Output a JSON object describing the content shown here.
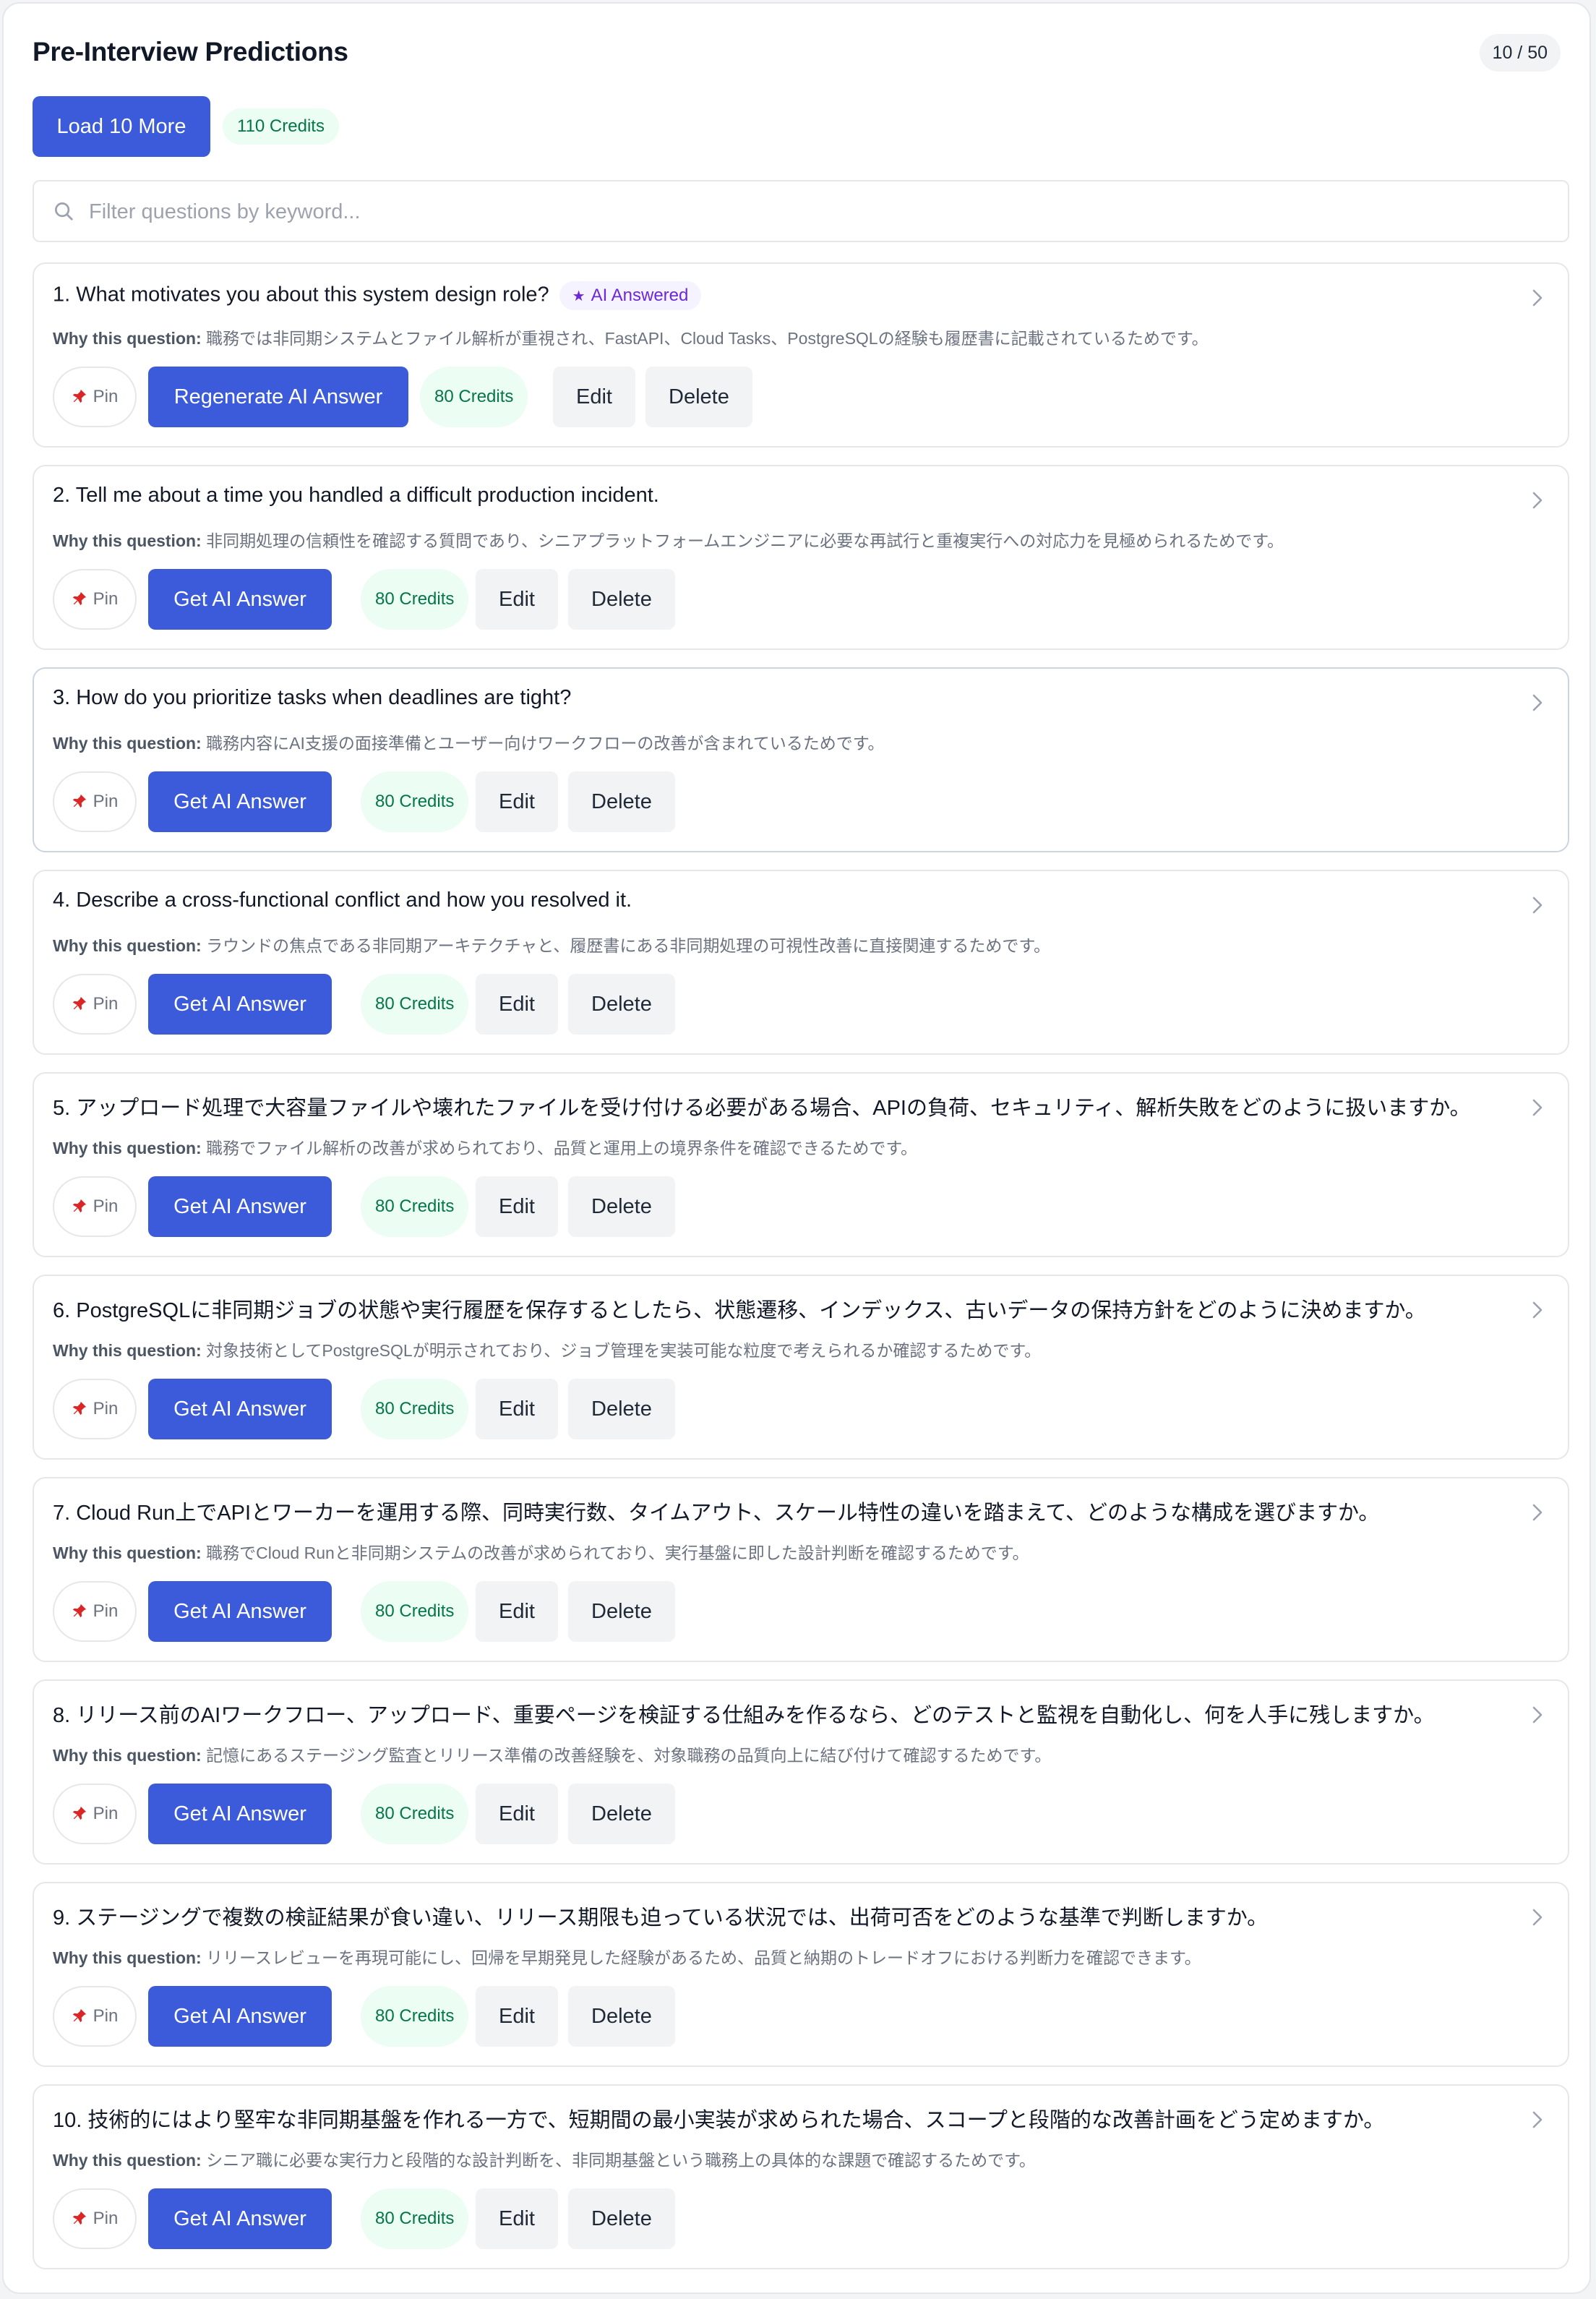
{
  "header": {
    "title": "Pre-Interview Predictions",
    "counter": "10 / 50"
  },
  "toolbar": {
    "load_more_label": "Load 10 More",
    "credits": "110 Credits"
  },
  "search": {
    "placeholder": "Filter questions by keyword...",
    "value": ""
  },
  "labels": {
    "why_prefix": "Why this question:",
    "pin": "Pin",
    "edit": "Edit",
    "delete": "Delete",
    "action_credits": "80 Credits",
    "ai_answered": "AI Answered"
  },
  "questions": [
    {
      "title": "1. What motivates you about this system design role?",
      "why": "職務では非同期システムとファイル解析が重視され、FastAPI、Cloud Tasks、PostgreSQLの経験も履歴書に記載されているためです。",
      "action": "Regenerate AI Answer",
      "answered": true
    },
    {
      "title": "2. Tell me about a time you handled a difficult production incident.",
      "why": "非同期処理の信頼性を確認する質問であり、シニアプラットフォームエンジニアに必要な再試行と重複実行への対応力を見極められるためです。",
      "action": "Get AI Answer",
      "answered": false
    },
    {
      "title": "3. How do you prioritize tasks when deadlines are tight?",
      "why": "職務内容にAI支援の面接準備とユーザー向けワークフローの改善が含まれているためです。",
      "action": "Get AI Answer",
      "answered": false
    },
    {
      "title": "4. Describe a cross-functional conflict and how you resolved it.",
      "why": "ラウンドの焦点である非同期アーキテクチャと、履歴書にある非同期処理の可視性改善に直接関連するためです。",
      "action": "Get AI Answer",
      "answered": false
    },
    {
      "title": "5. アップロード処理で大容量ファイルや壊れたファイルを受け付ける必要がある場合、APIの負荷、セキュリティ、解析失敗をどのように扱いますか。",
      "why": "職務でファイル解析の改善が求められており、品質と運用上の境界条件を確認できるためです。",
      "action": "Get AI Answer",
      "answered": false
    },
    {
      "title": "6. PostgreSQLに非同期ジョブの状態や実行履歴を保存するとしたら、状態遷移、インデックス、古いデータの保持方針をどのように決めますか。",
      "why": "対象技術としてPostgreSQLが明示されており、ジョブ管理を実装可能な粒度で考えられるか確認するためです。",
      "action": "Get AI Answer",
      "answered": false
    },
    {
      "title": "7. Cloud Run上でAPIとワーカーを運用する際、同時実行数、タイムアウト、スケール特性の違いを踏まえて、どのような構成を選びますか。",
      "why": "職務でCloud Runと非同期システムの改善が求められており、実行基盤に即した設計判断を確認するためです。",
      "action": "Get AI Answer",
      "answered": false
    },
    {
      "title": "8. リリース前のAIワークフロー、アップロード、重要ページを検証する仕組みを作るなら、どのテストと監視を自動化し、何を人手に残しますか。",
      "why": "記憶にあるステージング監査とリリース準備の改善経験を、対象職務の品質向上に結び付けて確認するためです。",
      "action": "Get AI Answer",
      "answered": false
    },
    {
      "title": "9. ステージングで複数の検証結果が食い違い、リリース期限も迫っている状況では、出荷可否をどのような基準で判断しますか。",
      "why": "リリースレビューを再現可能にし、回帰を早期発見した経験があるため、品質と納期のトレードオフにおける判断力を確認できます。",
      "action": "Get AI Answer",
      "answered": false
    },
    {
      "title": "10. 技術的にはより堅牢な非同期基盤を作れる一方で、短期間の最小実装が求められた場合、スコープと段階的な改善計画をどう定めますか。",
      "why": "シニア職に必要な実行力と段階的な設計判断を、非同期基盤という職務上の具体的な課題で確認するためです。",
      "action": "Get AI Answer",
      "answered": false
    }
  ],
  "colors": {
    "primary": "#3b5bdb",
    "credits_bg": "#ecfdf3",
    "credits_text": "#067647",
    "ai_tag_bg": "#f5f3ff",
    "ai_tag_text": "#6d28d9",
    "pin_icon": "#dc2626"
  }
}
